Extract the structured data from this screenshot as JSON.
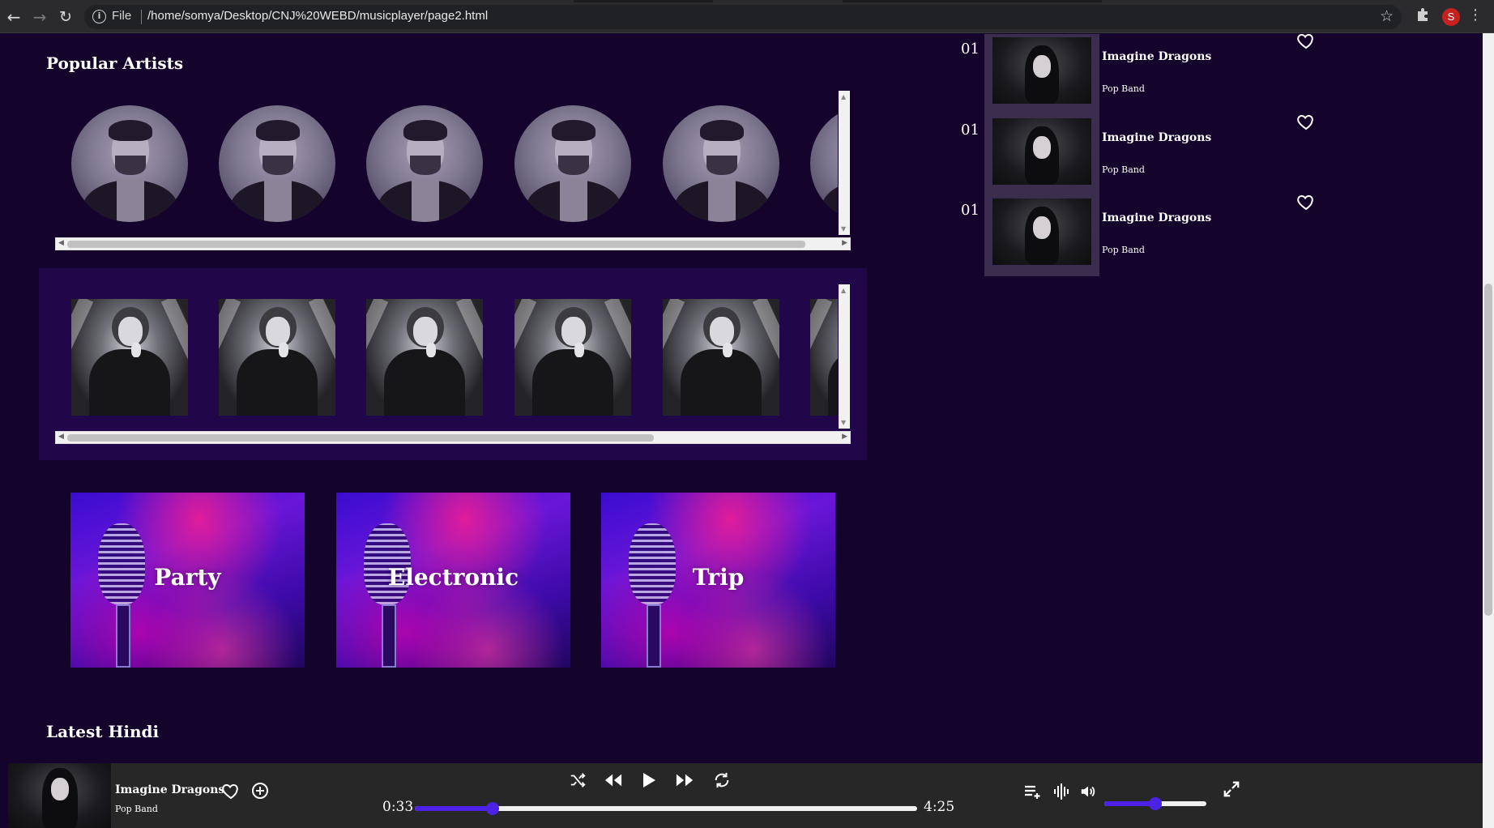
{
  "browser": {
    "file_label": "File",
    "url": "/home/somya/Desktop/CNJ%20WEBD/musicplayer/page2.html",
    "profile_initial": "S",
    "icons": {
      "back": "back-arrow-icon",
      "forward": "forward-arrow-icon",
      "reload": "reload-icon",
      "info": "info-icon",
      "bookmark": "star-icon",
      "extensions": "puzzle-icon",
      "menu": "kebab-menu-icon"
    }
  },
  "sections": {
    "popular_artists": "Popular Artists",
    "latest_hindi": "Latest Hindi"
  },
  "genres": [
    {
      "label": "Party"
    },
    {
      "label": "Electronic"
    },
    {
      "label": "Trip"
    }
  ],
  "tracks": [
    {
      "number": "01",
      "title": "Imagine Dragons",
      "subtitle": "Pop Band"
    },
    {
      "number": "01",
      "title": "Imagine Dragons",
      "subtitle": "Pop Band"
    },
    {
      "number": "01",
      "title": "Imagine Dragons",
      "subtitle": "Pop Band"
    }
  ],
  "player": {
    "title": "Imagine Dragons",
    "subtitle": "Pop Band",
    "current_time": "0:33",
    "total_time": "4:25",
    "progress": 0.155,
    "volume": 0.5,
    "icons": [
      "heart-icon",
      "add-circle-icon",
      "shuffle-icon",
      "rewind-icon",
      "play-icon",
      "fast-forward-icon",
      "repeat-icon",
      "queue-icon",
      "equalizer-icon",
      "volume-icon",
      "fullscreen-icon"
    ]
  },
  "colors": {
    "background": "#14032a",
    "accent": "#4b22e6",
    "player_bg": "#272727",
    "scroll_panel": "#22064a"
  }
}
